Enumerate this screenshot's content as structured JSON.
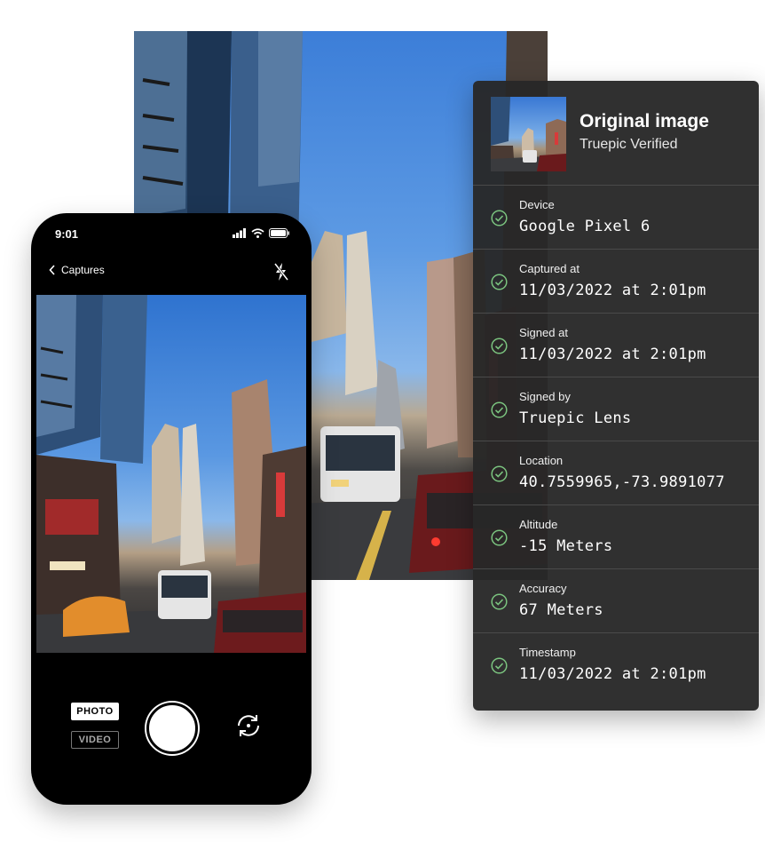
{
  "phone": {
    "time": "9:01",
    "back_label": "Captures",
    "mode_photo": "PHOTO",
    "mode_video": "VIDEO"
  },
  "panel": {
    "title": "Original image",
    "subtitle": "Truepic Verified",
    "fields": [
      {
        "label": "Device",
        "value": "Google Pixel 6"
      },
      {
        "label": "Captured at",
        "value": "11/03/2022 at 2:01pm"
      },
      {
        "label": "Signed at",
        "value": "11/03/2022 at 2:01pm"
      },
      {
        "label": "Signed by",
        "value": "Truepic Lens"
      },
      {
        "label": "Location",
        "value": "40.7559965,-73.9891077"
      },
      {
        "label": "Altitude",
        "value": "-15 Meters"
      },
      {
        "label": "Accuracy",
        "value": "67 Meters"
      },
      {
        "label": "Timestamp",
        "value": "11/03/2022 at 2:01pm"
      }
    ]
  },
  "colors": {
    "panel_bg": "#282828",
    "check_green": "#7bc47f",
    "phone_body": "#000000"
  }
}
